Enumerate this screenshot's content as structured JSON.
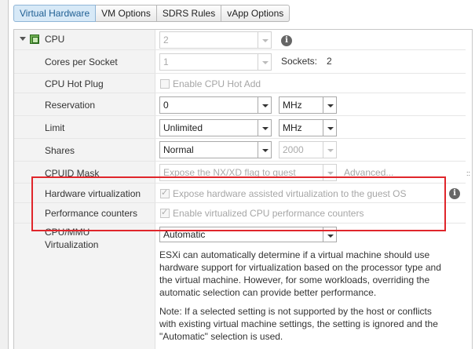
{
  "tabs": [
    "Virtual Hardware",
    "VM Options",
    "SDRS Rules",
    "vApp Options"
  ],
  "cpu": {
    "label": "CPU",
    "value": "2"
  },
  "cores_per_socket": {
    "label": "Cores per Socket",
    "value": "1",
    "sockets_label": "Sockets:",
    "sockets_value": "2"
  },
  "cpu_hot_plug": {
    "label": "CPU Hot Plug",
    "checkbox_label": "Enable CPU Hot Add",
    "checked": false
  },
  "reservation": {
    "label": "Reservation",
    "value": "0",
    "unit": "MHz"
  },
  "limit": {
    "label": "Limit",
    "value": "Unlimited",
    "unit": "MHz"
  },
  "shares": {
    "label": "Shares",
    "value": "Normal",
    "amount": "2000"
  },
  "cpuid_mask": {
    "label": "CPUID Mask",
    "value": "Expose the NX/XD flag to guest",
    "advanced_label": "Advanced..."
  },
  "hardware_virtualization": {
    "label": "Hardware virtualization",
    "checkbox_label": "Expose hardware assisted virtualization to the guest OS",
    "checked": true
  },
  "performance_counters": {
    "label": "Performance counters",
    "checkbox_label": "Enable virtualized CPU performance counters",
    "checked": true
  },
  "cpu_mmu": {
    "label_line1": "CPU/MMU",
    "label_line2": "Virtualization",
    "value": "Automatic",
    "description": "ESXi can automatically determine if a virtual machine should use hardware support for virtualization based on the processor type and the virtual machine. However, for some workloads, overriding the automatic selection can provide better performance.",
    "note": "Note: If a selected setting is not supported by the host or conflicts with existing virtual machine settings, the setting is ignored and the \"Automatic\" selection is used."
  },
  "colors": {
    "highlight_box": "#e0262b",
    "active_tab_bg": "#d7e9f7",
    "label_column_bg": "#f3f3f3"
  },
  "icons": [
    "expand-arrow-icon",
    "cpu-icon",
    "info-icon",
    "dropdown-arrow-icon",
    "checkbox-icon"
  ]
}
